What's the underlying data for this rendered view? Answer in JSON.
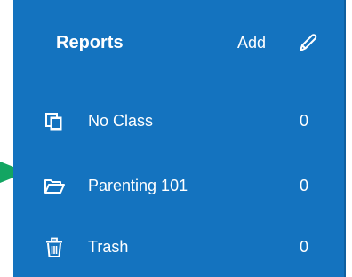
{
  "reports": {
    "title": "Reports",
    "add_label": "Add"
  },
  "items": [
    {
      "label": "No Class",
      "count": "0",
      "icon": "copy-icon"
    },
    {
      "label": "Parenting 101",
      "count": "0",
      "icon": "folder-open-icon"
    },
    {
      "label": "Trash",
      "count": "0",
      "icon": "trash-icon"
    }
  ],
  "colors": {
    "panel_bg": "#1473bf",
    "text": "#ffffff",
    "arrow": "#13a562"
  }
}
